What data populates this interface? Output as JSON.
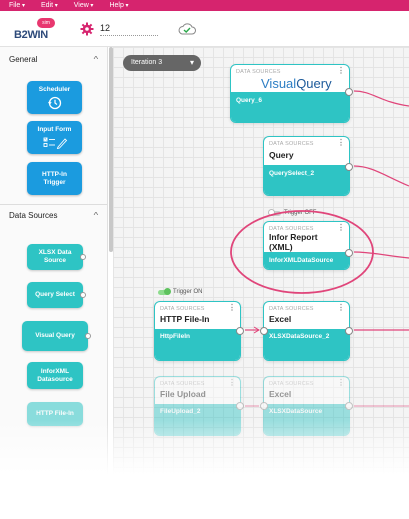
{
  "menu": [
    "File",
    "Edit",
    "View",
    "Help"
  ],
  "header": {
    "logo_badge": "sim",
    "logo_text": "B2WIN",
    "project_name": "12"
  },
  "sidebar": {
    "general": {
      "title": "General",
      "items": [
        {
          "label": "Scheduler",
          "icon": "clock-refresh-icon"
        },
        {
          "label": "Input Form",
          "icon": "form-checklist-icon"
        },
        {
          "label": "HTTP-In Trigger"
        }
      ]
    },
    "data_sources": {
      "title": "Data Sources",
      "items": [
        "XLSX Data Source",
        "Query Select",
        "Visual Query",
        "InforXML Datasource",
        "HTTP File-In"
      ]
    }
  },
  "canvas": {
    "iteration": "Iteration 3",
    "nodes": {
      "visual_query": {
        "kind": "DATA SOURCES",
        "logo_visual": "Visual",
        "logo_query": "Query",
        "footer": "Query_6"
      },
      "query": {
        "kind": "DATA SOURCES",
        "title": "Query",
        "footer": "QuerySelect_2"
      },
      "infor": {
        "kind": "DATA SOURCES",
        "title": "Infor Report (XML)",
        "footer": "InforXMLDataSource",
        "toggle": "Trigger OFF"
      },
      "excel": {
        "kind": "DATA SOURCES",
        "title": "Excel",
        "footer": "XLSXDataSource_2"
      },
      "http": {
        "kind": "DATA SOURCES",
        "title": "HTTP File-In",
        "footer": "HttpFileIn",
        "toggle": "Trigger ON"
      },
      "file_upload": {
        "kind": "DATA SOURCES",
        "title": "File Upload",
        "footer": "FileUpload_2"
      },
      "excel2": {
        "kind": "DATA SOURCES",
        "title": "Excel",
        "footer": "XLSXDataSource"
      }
    }
  },
  "colors": {
    "accent": "#d6246e",
    "node_teal": "#2ec4c4",
    "button_blue": "#1b9bdf",
    "highlight": "#e0457a"
  }
}
